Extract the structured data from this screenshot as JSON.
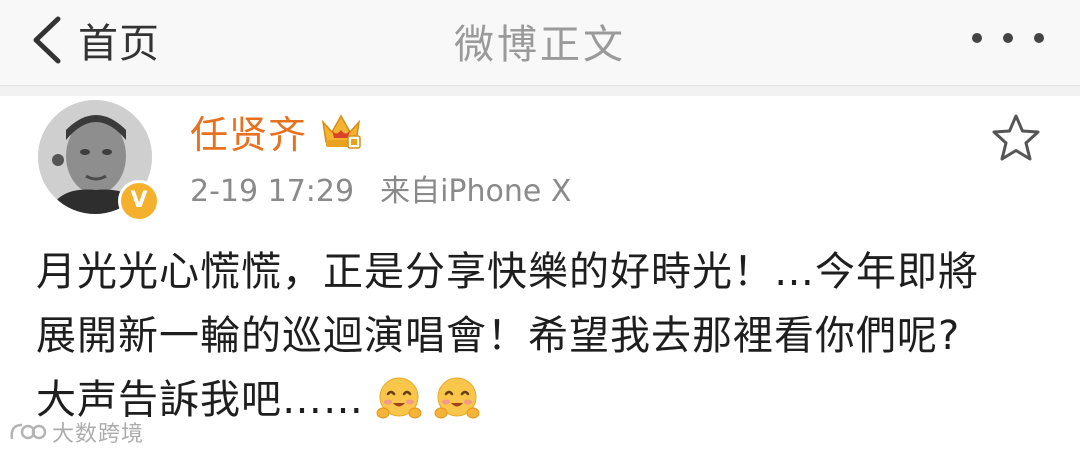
{
  "nav": {
    "back_label": "首页",
    "title": "微博正文",
    "more_icon": "more-dots-icon"
  },
  "post": {
    "author": {
      "name": "任贤齐",
      "verified_badge": "V",
      "badge_icon": "crown-member-icon"
    },
    "time": "2-19 17:29",
    "source": "来自iPhone X",
    "favorite_icon": "star-outline-icon",
    "text_lines": [
      "月光光心慌慌，正是分享快樂的好時光！…今年即將",
      "展開新一輪的巡迴演唱會！希望我去那裡看你們呢?",
      "大声告訴我吧……"
    ],
    "emojis": [
      "hug-emoji",
      "hug-emoji"
    ]
  },
  "watermark": {
    "text": "大数跨境"
  },
  "colors": {
    "username": "#e8711f",
    "badge": "#f5b12d",
    "nav_title": "#9a9a9a",
    "meta": "#8a8a8a"
  }
}
